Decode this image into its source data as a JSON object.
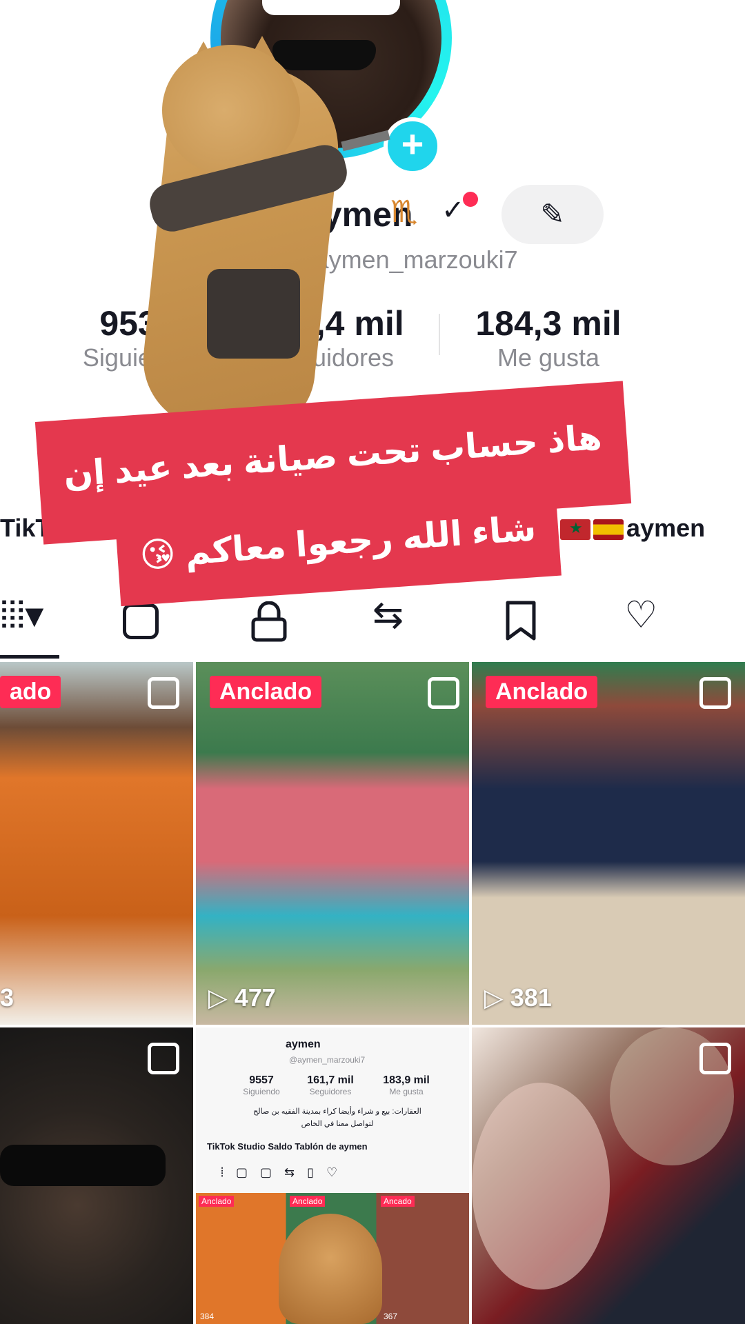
{
  "profile": {
    "username": "aymen",
    "handle": "@aymen_marzouki7",
    "edit_icon": "pencil-icon",
    "stats": [
      {
        "value": "9537",
        "label": "Siguiendo"
      },
      {
        "value": "161,4 mil",
        "label": "Seguidores"
      },
      {
        "value": "184,3 mil",
        "label": "Me gusta"
      }
    ],
    "bio": "… وأيضا … الفقيه بن صالح",
    "links": {
      "left": "TikTok S",
      "right": "aymen",
      "right_prefix": "e"
    }
  },
  "tabs": [
    {
      "icon": "grid-icon",
      "glyph": "⦙⦙⦙▾"
    },
    {
      "icon": "repost-sticker-icon",
      "glyph": "▢"
    },
    {
      "icon": "lock-icon",
      "glyph": "🔒"
    },
    {
      "icon": "repost-icon",
      "glyph": "⇆"
    },
    {
      "icon": "bookmark-icon",
      "glyph": "🔖"
    },
    {
      "icon": "heart-icon",
      "glyph": "♡"
    }
  ],
  "banner": {
    "line1": "هاذ حساب تحت صيانة بعد عيد إن",
    "line2": "شاء الله رجعوا معاكم 😘"
  },
  "videos": [
    {
      "pin": "ado",
      "views": "3",
      "colors": [
        "#e0762a",
        "#c96119",
        "#6d4c37"
      ]
    },
    {
      "pin": "Anclado",
      "views": "477",
      "colors": [
        "#3c7a4d",
        "#d96a78",
        "#33b2c4"
      ]
    },
    {
      "pin": "Anclado",
      "views": "381",
      "colors": [
        "#8e4a3b",
        "#1e2b4a",
        "#d9cbb5"
      ]
    },
    {
      "pin": "",
      "views": "",
      "colors": [
        "#151515",
        "#2a2420",
        "#4a3a30"
      ]
    },
    {
      "pin": "",
      "views": "",
      "colors": [
        "#f4f4f4",
        "#e8e8e8",
        "#d9a36a"
      ],
      "inner": {
        "username": "aymen",
        "handle": "@aymen_marzouki7",
        "stats": [
          {
            "value": "9557",
            "label": "Siguiendo"
          },
          {
            "value": "161,7 mil",
            "label": "Seguidores"
          },
          {
            "value": "183,9 mil",
            "label": "Me gusta"
          }
        ],
        "bio1": "العقارات: بيع و شراء وأيضا كراء بمدينة الفقيه بن صالح",
        "bio2": "لتواصل معنا في الخاص",
        "links": "TikTok Studio   Saldo   Tablón de aymen",
        "pins": [
          "Anclado",
          "Anclado",
          "Ancado"
        ],
        "views": [
          "384",
          "367"
        ]
      }
    },
    {
      "pin": "",
      "views": "",
      "colors": [
        "#7a1d22",
        "#1f2533",
        "#d7b07a"
      ]
    }
  ],
  "colors": {
    "accent": "#fe2c55",
    "ring": "#20d5ec",
    "banner": "#e4384e"
  }
}
